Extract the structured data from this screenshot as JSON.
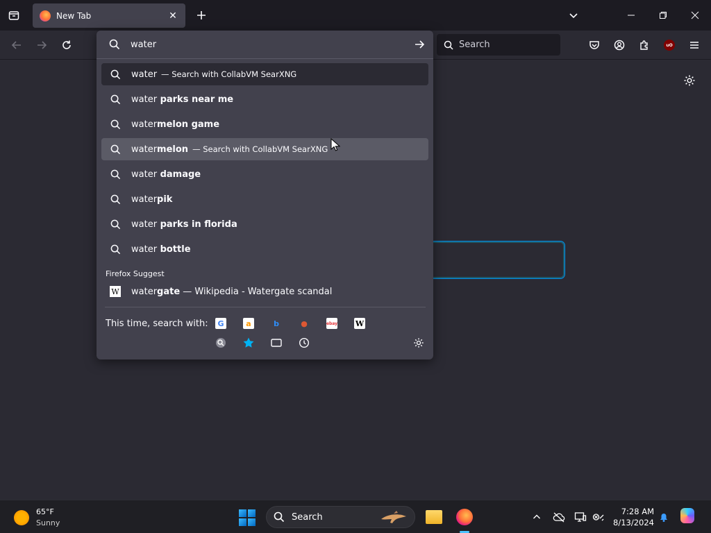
{
  "browser": {
    "tab": {
      "title": "New Tab"
    },
    "search_box": {
      "placeholder": "Search"
    }
  },
  "urlbar": {
    "value": "water",
    "results": [
      {
        "typed": "water",
        "bold": "",
        "action": "— Search with CollabVM SearXNG",
        "state": "selected"
      },
      {
        "typed": "water",
        "bold": " parks near me",
        "action": "",
        "state": ""
      },
      {
        "typed": "water",
        "bold": "melon game",
        "action": "",
        "state": ""
      },
      {
        "typed": "water",
        "bold": "melon",
        "action": "— Search with CollabVM SearXNG",
        "state": "hover"
      },
      {
        "typed": "water",
        "bold": " damage",
        "action": "",
        "state": ""
      },
      {
        "typed": "water",
        "bold": "pik",
        "action": "",
        "state": ""
      },
      {
        "typed": "water",
        "bold": " parks in florida",
        "action": "",
        "state": ""
      },
      {
        "typed": "water",
        "bold": " bottle",
        "action": "",
        "state": ""
      }
    ],
    "suggest_group_label": "Firefox Suggest",
    "wiki_result": {
      "typed": "water",
      "bold": "gate",
      "rest": " — Wikipedia - Watergate scandal",
      "icon_letter": "W"
    },
    "one_off_label": "This time, search with:",
    "engines": [
      {
        "name": "google-icon",
        "glyph": "G",
        "color": "#4285f4"
      },
      {
        "name": "amazon-icon",
        "glyph": "a",
        "color": "#ff9900"
      },
      {
        "name": "bing-icon",
        "glyph": "b",
        "color": "#2f8ef9"
      },
      {
        "name": "duckduckgo-icon",
        "glyph": "●",
        "color": "#de5833"
      },
      {
        "name": "ebay-icon",
        "glyph": "ebay",
        "color": "#e53238"
      },
      {
        "name": "wikipedia-icon",
        "glyph": "W",
        "color": "#000000"
      }
    ]
  },
  "taskbar": {
    "weather_temp": "65°F",
    "weather_cond": "Sunny",
    "search_label": "Search",
    "time": "7:28 AM",
    "date": "8/13/2024"
  },
  "colors": {
    "accent": "#0090ed",
    "popup_bg": "#42414d",
    "page_bg": "#2b2a33"
  }
}
